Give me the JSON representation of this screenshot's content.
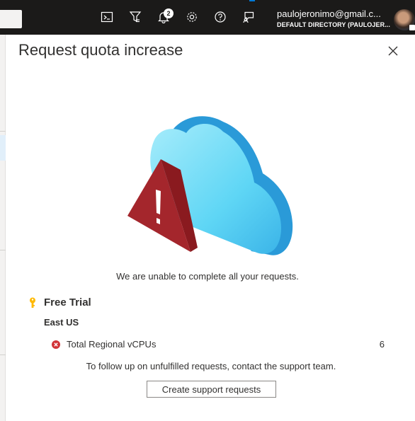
{
  "topbar": {
    "notification_count": "2",
    "account_email": "paulojeronimo@gmail.c...",
    "account_directory": "DEFAULT DIRECTORY (PAULOJER...",
    "icons": [
      "cloud-shell-icon",
      "directory-filter-icon",
      "notifications-icon",
      "settings-icon",
      "help-icon",
      "feedback-icon"
    ]
  },
  "panel": {
    "title": "Request quota increase",
    "message": "We are unable to complete all your requests.",
    "subscription": "Free Trial",
    "region": "East US",
    "quotas": [
      {
        "name": "Total Regional vCPUs",
        "value": "6",
        "status": "error"
      }
    ],
    "followup": "To follow up on unfulfilled requests, contact the support team.",
    "support_button_label": "Create support requests"
  },
  "colors": {
    "topbar_bg": "#1b1a19",
    "accent": "#0078d4",
    "error": "#d13438",
    "key_icon": "#ffb900",
    "cloud": "#50c8f0",
    "warning_triangle": "#a4262c"
  }
}
